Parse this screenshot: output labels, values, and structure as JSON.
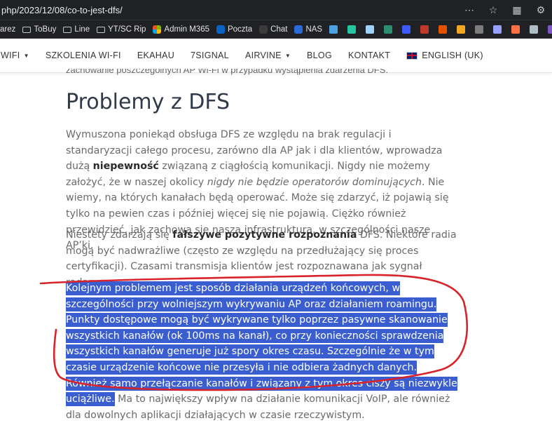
{
  "browser": {
    "url": "php/2023/12/08/co-to-jest-dfs/",
    "bookmarks": [
      "arez",
      "ToBuy",
      "Line",
      "YT/SC Rip",
      "Admin M365",
      "Poczta",
      "Chat",
      "NAS"
    ]
  },
  "nav": {
    "items": [
      "WIFI",
      "SZKOLENIA WI-FI",
      "EKAHAU",
      "7SIGNAL",
      "AIRVINE",
      "BLOG",
      "KONTAKT"
    ],
    "language": "ENGLISH (UK)"
  },
  "article": {
    "peek_text": "zachowanie poszczególnych AP Wi-Fi w przypadku wystąpienia zdarzenia DFS.",
    "heading": "Problemy z DFS",
    "p1": {
      "a": "Wymuszona poniekąd obsługa DFS ze względu na brak regulacji i standaryzacji całego procesu, zarówno dla AP jak i dla klientów, wprowadza dużą ",
      "b": "niepewność",
      "c": " związaną z ciągłością komunikacji. Nigdy nie możemy założyć, że w naszej okolicy ",
      "d": "nigdy nie będzie operatorów dominujących",
      "e": ". Nie wiemy, na których kanałach będą operować. Może się zdarzyć, iż pojawią się tylko na pewien czas i później więcej się nie pojawią. Ciężko również przewidzieć, jak zachowa się nasza infrastruktura, w szczególności nasze AP’ki."
    },
    "p2": {
      "a": "Niestety zdarzają się ",
      "b": "fałszywe pozytywne rozpoznania",
      "c": " DFS. Niektóre radia mogą być nadwrażliwe (często ze względu na przedłużający się proces certyfikacji). Czasami transmisja klientów jest rozpoznawana jak sygnał radaru."
    },
    "p3": {
      "highlighted": "Kolejnym problemem jest sposób działania urządzeń końcowych, w szczególności przy wolniejszym wykrywaniu AP oraz działaniem roamingu. Punkty dostępowe mogą być wykrywane tylko poprzez pasywne skanowanie wszystkich kanałów (ok 100ms na kanał), co przy konieczności sprawdzenia wszystkich kanałów generuje już spory okres czasu. Szczególnie że w tym czasie urządzenie końcowe nie przesyła i nie odbiera żadnych danych. Również samo przełączanie kanałów i związany z tym okres ciszy są niezwykle uciążliwe.",
      "rest": " Ma to największy wpływ na działanie komunikacji VoIP, ale również dla dowolnych aplikacji działających w czasie rzeczywistym."
    }
  },
  "colors": {
    "highlight": "#3a5ed0",
    "annotation": "#d8232a",
    "chrome": "#202124"
  }
}
